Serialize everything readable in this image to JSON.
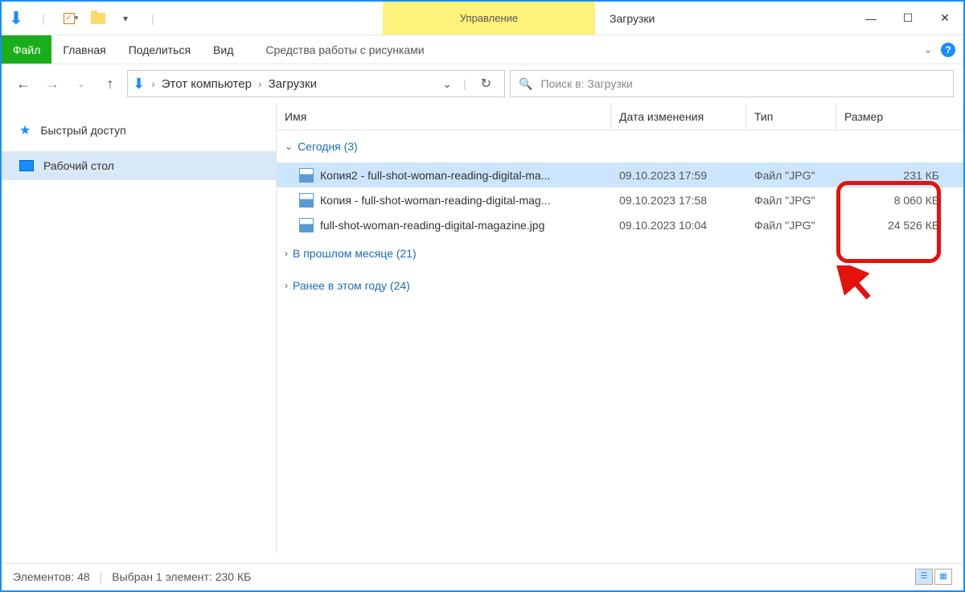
{
  "window": {
    "title": "Загрузки",
    "manage_tab": "Управление"
  },
  "ribbon": {
    "file": "Файл",
    "home": "Главная",
    "share": "Поделиться",
    "view": "Вид",
    "tools": "Средства работы с рисунками"
  },
  "breadcrumb": {
    "root": "Этот компьютер",
    "folder": "Загрузки"
  },
  "search": {
    "placeholder": "Поиск в: Загрузки"
  },
  "sidebar": {
    "quick": "Быстрый доступ",
    "desktop": "Рабочий стол"
  },
  "columns": {
    "name": "Имя",
    "date": "Дата изменения",
    "type": "Тип",
    "size": "Размер"
  },
  "groups": {
    "today": "Сегодня (3)",
    "lastmonth": "В прошлом месяце (21)",
    "earlier": "Ранее в этом году (24)"
  },
  "files": [
    {
      "name": "Копия2 - full-shot-woman-reading-digital-ma...",
      "date": "09.10.2023 17:59",
      "type": "Файл \"JPG\"",
      "size": "231 КБ",
      "selected": true
    },
    {
      "name": "Копия - full-shot-woman-reading-digital-mag...",
      "date": "09.10.2023 17:58",
      "type": "Файл \"JPG\"",
      "size": "8 060 КБ",
      "selected": false
    },
    {
      "name": "full-shot-woman-reading-digital-magazine.jpg",
      "date": "09.10.2023 10:04",
      "type": "Файл \"JPG\"",
      "size": "24 526 КБ",
      "selected": false
    }
  ],
  "status": {
    "count_label": "Элементов:",
    "count": "48",
    "selected": "Выбран 1 элемент: 230 КБ"
  }
}
